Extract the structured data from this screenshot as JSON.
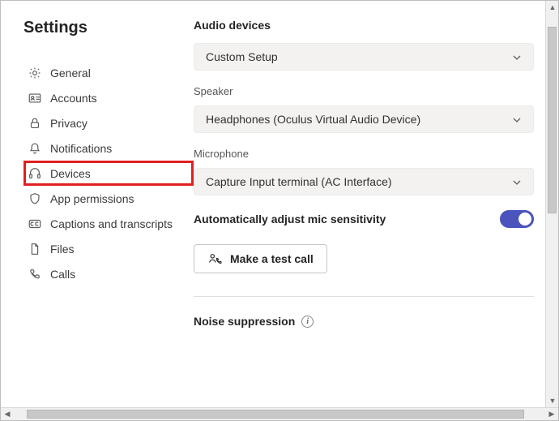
{
  "page_title": "Settings",
  "sidebar": {
    "items": [
      {
        "label": "General",
        "icon": "gear-icon"
      },
      {
        "label": "Accounts",
        "icon": "id-card-icon"
      },
      {
        "label": "Privacy",
        "icon": "lock-icon"
      },
      {
        "label": "Notifications",
        "icon": "bell-icon"
      },
      {
        "label": "Devices",
        "icon": "headset-icon",
        "highlighted": true
      },
      {
        "label": "App permissions",
        "icon": "shield-icon"
      },
      {
        "label": "Captions and transcripts",
        "icon": "cc-icon"
      },
      {
        "label": "Files",
        "icon": "file-icon"
      },
      {
        "label": "Calls",
        "icon": "phone-icon"
      }
    ]
  },
  "content": {
    "audio_devices_heading": "Audio devices",
    "audio_devices_value": "Custom Setup",
    "speaker_label": "Speaker",
    "speaker_value": "Headphones (Oculus Virtual Audio Device)",
    "microphone_label": "Microphone",
    "microphone_value": "Capture Input terminal (AC Interface)",
    "auto_mic_label": "Automatically adjust mic sensitivity",
    "auto_mic_on": true,
    "test_call_label": "Make a test call",
    "noise_suppression_heading": "Noise suppression",
    "noise_suppression_hint_glyph": "i"
  }
}
